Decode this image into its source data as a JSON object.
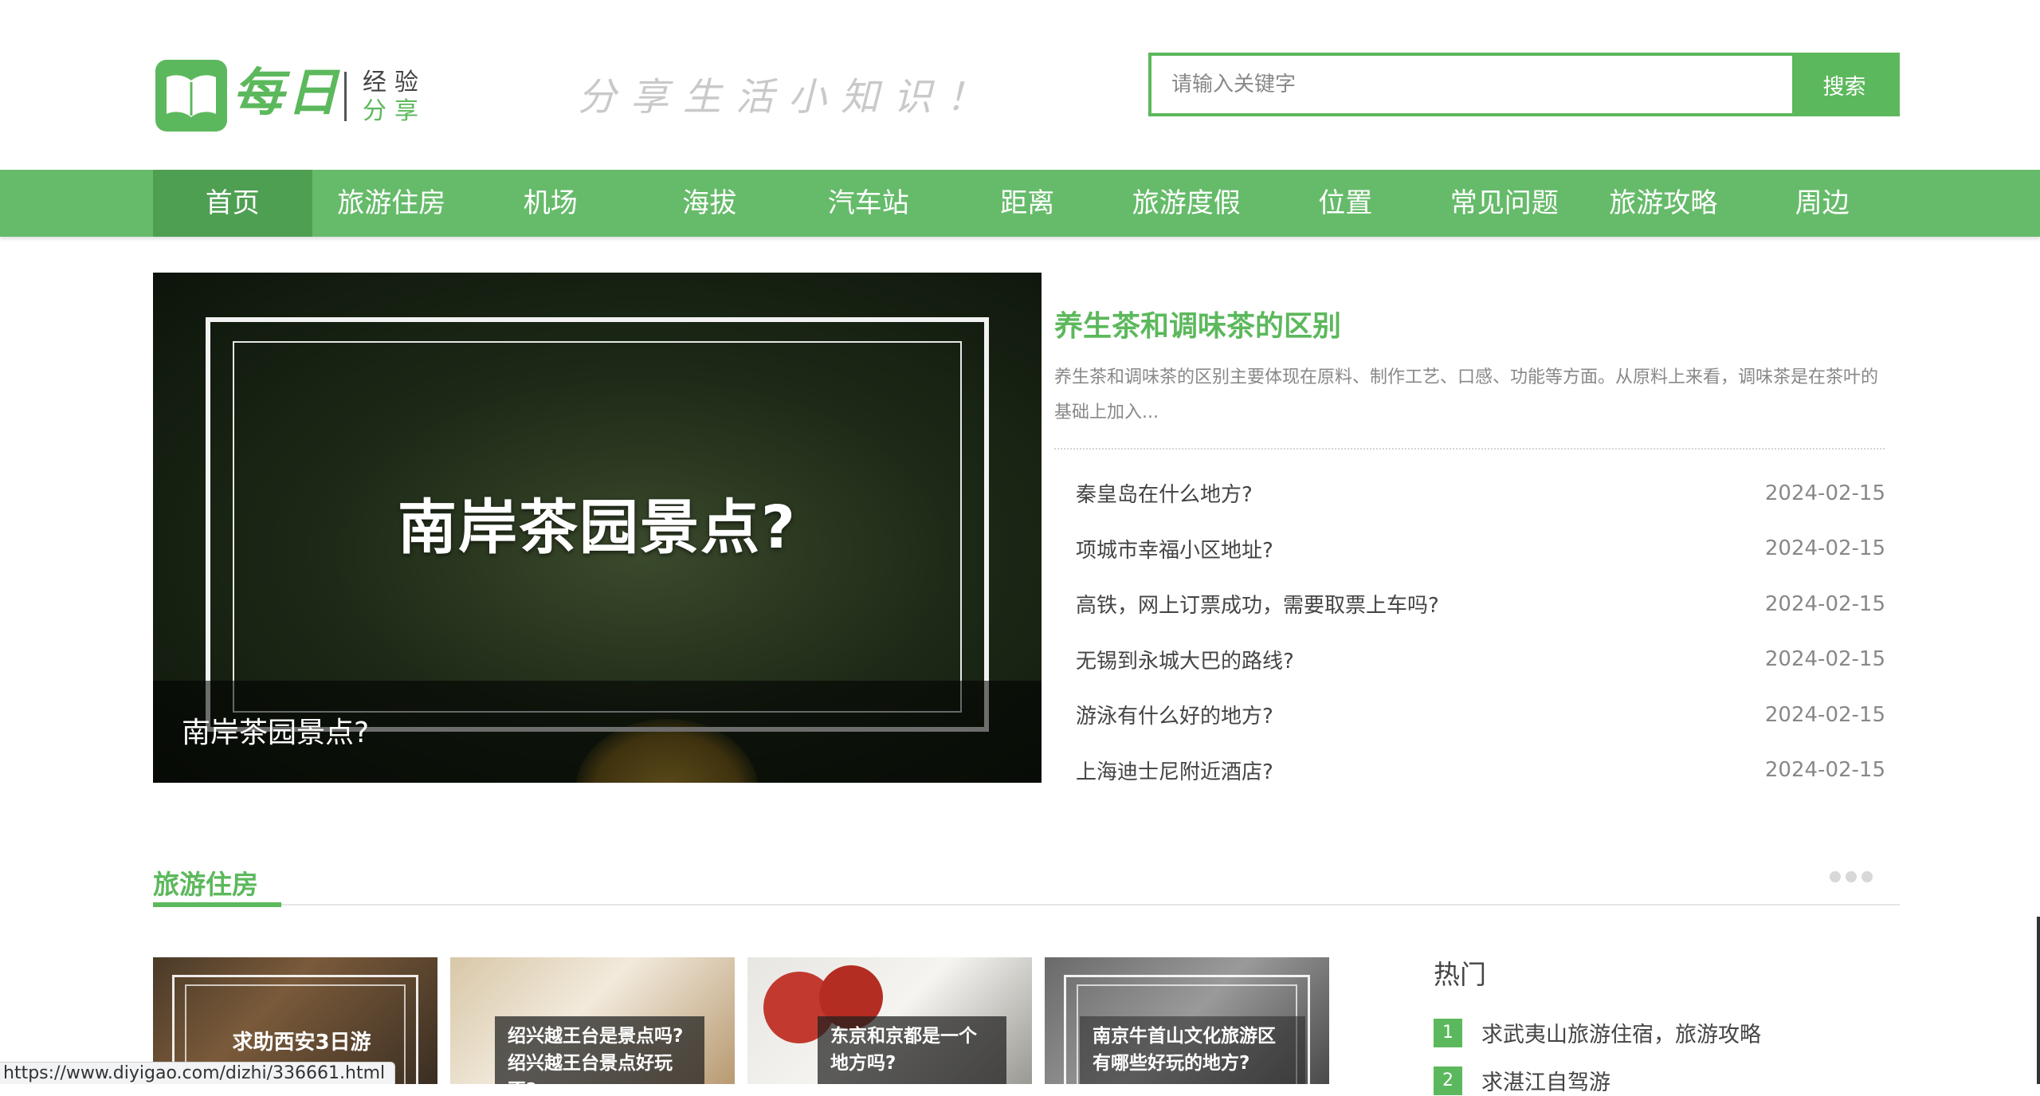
{
  "header": {
    "logo_main": "每日",
    "logo_sub1": "经验",
    "logo_sub2": "分享",
    "slogan": "分享生活小知识！",
    "search": {
      "placeholder": "请输入关键字",
      "button_label": "搜索"
    }
  },
  "nav": {
    "items": [
      {
        "label": "首页",
        "active": true
      },
      {
        "label": "旅游住房"
      },
      {
        "label": "机场"
      },
      {
        "label": "海拔"
      },
      {
        "label": "汽车站"
      },
      {
        "label": "距离"
      },
      {
        "label": "旅游度假"
      },
      {
        "label": "位置"
      },
      {
        "label": "常见问题"
      },
      {
        "label": "旅游攻略"
      },
      {
        "label": "周边"
      }
    ]
  },
  "hero": {
    "image_title": "南岸茶园景点?",
    "caption": "南岸茶园景点?"
  },
  "featured": {
    "title": "养生茶和调味茶的区别",
    "description": "养生茶和调味茶的区别主要体现在原料、制作工艺、口感、功能等方面。从原料上来看，调味茶是在茶叶的基础上加入..."
  },
  "news": [
    {
      "title": "秦皇岛在什么地方?",
      "date": "2024-02-15"
    },
    {
      "title": "项城市幸福小区地址?",
      "date": "2024-02-15"
    },
    {
      "title": "高铁，网上订票成功，需要取票上车吗?",
      "date": "2024-02-15"
    },
    {
      "title": "无锡到永城大巴的路线?",
      "date": "2024-02-15"
    },
    {
      "title": "游泳有什么好的地方?",
      "date": "2024-02-15"
    },
    {
      "title": "上海迪士尼附近酒店?",
      "date": "2024-02-15"
    }
  ],
  "section": {
    "title": "旅游住房",
    "cards": [
      {
        "text": "求助西安3日游"
      },
      {
        "text": "绍兴越王台是景点吗?绍兴越王台景点好玩不?"
      },
      {
        "text": "东京和京都是一个地方吗?"
      },
      {
        "text": "南京牛首山文化旅游区有哪些好玩的地方?"
      }
    ]
  },
  "hot": {
    "title": "热门",
    "items": [
      {
        "num": "1",
        "text": "求武夷山旅游住宿，旅游攻略"
      },
      {
        "num": "2",
        "text": "求湛江自驾游"
      }
    ]
  },
  "status_url": "https://www.diyigao.com/dizhi/336661.html",
  "colors": {
    "accent": "#5cb85c",
    "nav_bg": "#66bb6a",
    "nav_active": "#4f9f53"
  }
}
